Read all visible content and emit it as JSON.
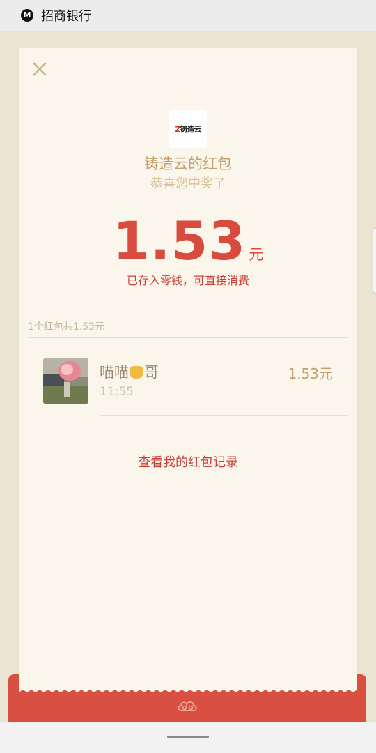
{
  "status_bar": {
    "app_name": "招商银行"
  },
  "packet": {
    "logo_text": "铸造云",
    "title": "铸造云的红包",
    "subtitle": "恭喜您中奖了",
    "amount": "1.53",
    "currency": "元",
    "note": "已存入零钱，可直接消费"
  },
  "summary": "1个红包共1.53元",
  "records": [
    {
      "name_prefix": "喵喵",
      "name_suffix": "哥",
      "time": "11:55",
      "amount": "1.53元"
    }
  ],
  "history_link": "查看我的红包记录",
  "colors": {
    "accent_red": "#d94a3f",
    "gold": "#c29f6c",
    "card_bg": "#faf6eb"
  },
  "icons": {
    "close": "close-icon",
    "cat": "cat-face-icon",
    "cloud": "cloud-pattern-icon"
  }
}
